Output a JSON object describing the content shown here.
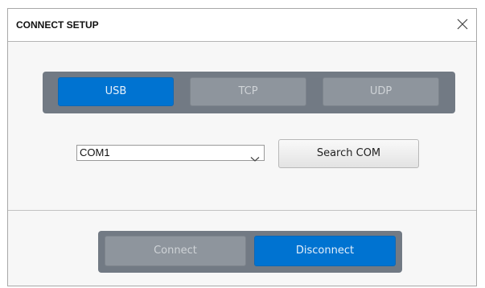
{
  "dialog": {
    "title": "CONNECT SETUP",
    "close_icon": "close-icon"
  },
  "protocol": {
    "options": [
      {
        "label": "USB",
        "selected": true
      },
      {
        "label": "TCP",
        "selected": false
      },
      {
        "label": "UDP",
        "selected": false
      }
    ]
  },
  "port": {
    "selected": "COM1",
    "search_label": "Search COM"
  },
  "connection": {
    "connect_label": "Connect",
    "disconnect_label": "Disconnect",
    "active": "Disconnect"
  },
  "colors": {
    "active_blue": "#0073d1",
    "segment_bg": "#727a84",
    "inactive_option": "#8e959d"
  }
}
